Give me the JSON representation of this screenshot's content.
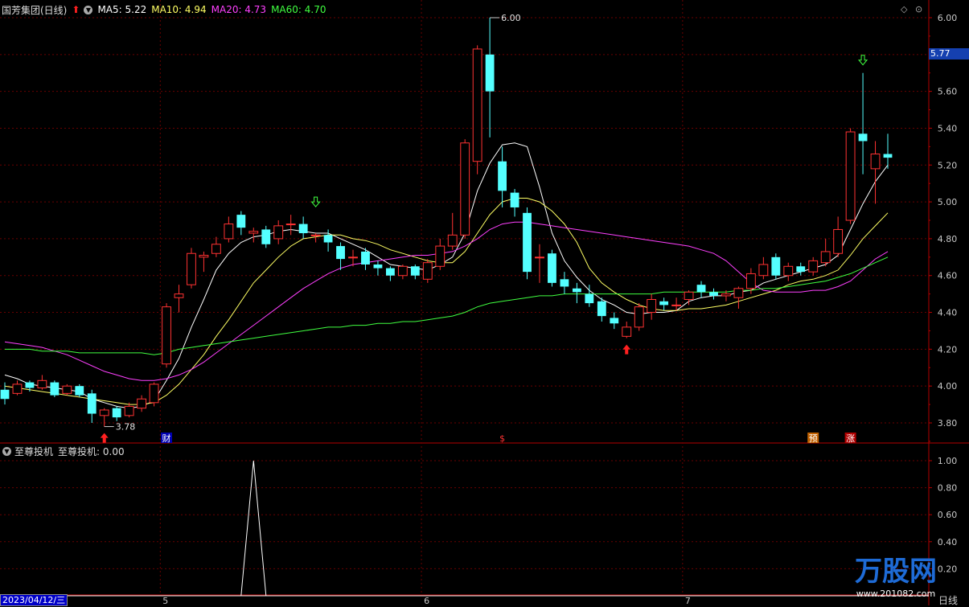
{
  "header": {
    "stock_name": "国芳集团(日线)",
    "ma5_label": "MA5: 5.22",
    "ma10_label": "MA10: 4.94",
    "ma20_label": "MA20: 4.73",
    "ma60_label": "MA60: 4.70"
  },
  "sub_header": {
    "indicator_name": "至尊投机",
    "indicator_value": "至尊投机: 0.00"
  },
  "current_price": "5.77",
  "period_label": "日线",
  "date_label": "2023/04/12/三",
  "colors": {
    "up": "#ff3232",
    "down": "#54ffff",
    "ma5": "#ffffff",
    "ma10": "#ffff64",
    "ma20": "#ff40ff",
    "ma60": "#40ff40",
    "axis": "#b40000"
  },
  "watermark": {
    "text": "万股网",
    "url": "www.201082.com"
  },
  "chart_data": {
    "type": "candlestick",
    "y_axis": {
      "ticks": [
        "6.00",
        "5.80",
        "5.60",
        "5.40",
        "5.20",
        "5.00",
        "4.80",
        "4.60",
        "4.40",
        "4.20",
        "4.00",
        "3.80"
      ],
      "ylim": [
        3.7,
        6.1
      ]
    },
    "month_labels": [
      {
        "label": "5",
        "index": 13
      },
      {
        "label": "6",
        "index": 34
      },
      {
        "label": "7",
        "index": 55
      }
    ],
    "candles": [
      [
        3.98,
        3.93,
        4.02,
        3.9
      ],
      [
        3.96,
        4.01,
        4.03,
        3.95
      ],
      [
        4.02,
        3.99,
        4.03,
        3.97
      ],
      [
        3.99,
        4.03,
        4.06,
        3.98
      ],
      [
        4.02,
        3.95,
        4.03,
        3.94
      ],
      [
        3.96,
        4.0,
        4.01,
        3.95
      ],
      [
        4.0,
        3.95,
        4.01,
        3.94
      ],
      [
        3.96,
        3.85,
        3.98,
        3.8
      ],
      [
        3.84,
        3.87,
        3.88,
        3.78
      ],
      [
        3.88,
        3.83,
        3.89,
        3.81
      ],
      [
        3.84,
        3.89,
        3.91,
        3.83
      ],
      [
        3.88,
        3.93,
        3.95,
        3.86
      ],
      [
        3.91,
        4.01,
        4.02,
        3.89
      ],
      [
        4.12,
        4.43,
        4.45,
        4.1
      ],
      [
        4.48,
        4.5,
        4.55,
        4.4
      ],
      [
        4.55,
        4.72,
        4.75,
        4.53
      ],
      [
        4.7,
        4.71,
        4.73,
        4.62
      ],
      [
        4.72,
        4.77,
        4.81,
        4.7
      ],
      [
        4.8,
        4.88,
        4.92,
        4.78
      ],
      [
        4.93,
        4.86,
        4.95,
        4.82
      ],
      [
        4.83,
        4.84,
        4.86,
        4.78
      ],
      [
        4.85,
        4.77,
        4.87,
        4.75
      ],
      [
        4.8,
        4.87,
        4.9,
        4.77
      ],
      [
        4.88,
        4.88,
        4.93,
        4.82
      ],
      [
        4.88,
        4.83,
        4.92,
        4.8
      ],
      [
        4.82,
        4.82,
        4.83,
        4.78
      ],
      [
        4.82,
        4.78,
        4.85,
        4.73
      ],
      [
        4.76,
        4.69,
        4.78,
        4.63
      ],
      [
        4.7,
        4.7,
        4.74,
        4.65
      ],
      [
        4.73,
        4.66,
        4.75,
        4.63
      ],
      [
        4.66,
        4.64,
        4.68,
        4.6
      ],
      [
        4.64,
        4.6,
        4.65,
        4.57
      ],
      [
        4.6,
        4.65,
        4.66,
        4.58
      ],
      [
        4.65,
        4.6,
        4.66,
        4.58
      ],
      [
        4.58,
        4.67,
        4.69,
        4.56
      ],
      [
        4.65,
        4.76,
        4.8,
        4.63
      ],
      [
        4.76,
        4.82,
        4.94,
        4.74
      ],
      [
        4.82,
        5.32,
        5.34,
        4.8
      ],
      [
        5.22,
        5.83,
        5.85,
        5.15
      ],
      [
        5.8,
        5.6,
        6.0,
        5.35
      ],
      [
        5.22,
        5.06,
        5.3,
        4.97
      ],
      [
        5.05,
        4.97,
        5.07,
        4.92
      ],
      [
        4.94,
        4.62,
        4.97,
        4.58
      ],
      [
        4.7,
        4.7,
        4.77,
        4.56
      ],
      [
        4.72,
        4.56,
        4.74,
        4.54
      ],
      [
        4.58,
        4.54,
        4.62,
        4.5
      ],
      [
        4.53,
        4.51,
        4.56,
        4.45
      ],
      [
        4.5,
        4.45,
        4.55,
        4.43
      ],
      [
        4.46,
        4.38,
        4.48,
        4.35
      ],
      [
        4.37,
        4.34,
        4.4,
        4.31
      ],
      [
        4.27,
        4.32,
        4.35,
        4.26
      ],
      [
        4.32,
        4.43,
        4.45,
        4.3
      ],
      [
        4.4,
        4.47,
        4.5,
        4.36
      ],
      [
        4.46,
        4.44,
        4.48,
        4.41
      ],
      [
        4.44,
        4.44,
        4.48,
        4.41
      ],
      [
        4.47,
        4.51,
        4.52,
        4.44
      ],
      [
        4.55,
        4.51,
        4.57,
        4.48
      ],
      [
        4.51,
        4.49,
        4.53,
        4.47
      ],
      [
        4.49,
        4.5,
        4.52,
        4.46
      ],
      [
        4.48,
        4.53,
        4.54,
        4.42
      ],
      [
        4.53,
        4.61,
        4.64,
        4.5
      ],
      [
        4.6,
        4.66,
        4.7,
        4.58
      ],
      [
        4.7,
        4.6,
        4.72,
        4.58
      ],
      [
        4.6,
        4.65,
        4.67,
        4.57
      ],
      [
        4.65,
        4.62,
        4.67,
        4.6
      ],
      [
        4.62,
        4.68,
        4.7,
        4.6
      ],
      [
        4.67,
        4.73,
        4.8,
        4.65
      ],
      [
        4.72,
        4.85,
        4.92,
        4.7
      ],
      [
        4.9,
        5.38,
        5.4,
        4.88
      ],
      [
        5.37,
        5.33,
        5.7,
        5.15
      ],
      [
        5.18,
        5.26,
        5.33,
        4.99
      ],
      [
        5.26,
        5.24,
        5.37,
        5.18
      ]
    ],
    "series": [
      {
        "name": "MA5",
        "values": [
          4.06,
          4.04,
          4.01,
          4.0,
          3.99,
          3.98,
          3.97,
          3.93,
          3.91,
          3.89,
          3.88,
          3.89,
          3.92,
          4.03,
          4.15,
          4.32,
          4.47,
          4.63,
          4.72,
          4.78,
          4.81,
          4.82,
          4.84,
          4.85,
          4.84,
          4.83,
          4.83,
          4.8,
          4.77,
          4.74,
          4.7,
          4.66,
          4.65,
          4.64,
          4.63,
          4.66,
          4.7,
          4.83,
          5.06,
          5.21,
          5.31,
          5.32,
          5.3,
          5.08,
          4.83,
          4.68,
          4.59,
          4.52,
          4.47,
          4.44,
          4.4,
          4.39,
          4.4,
          4.4,
          4.41,
          4.46,
          4.48,
          4.49,
          4.49,
          4.51,
          4.52,
          4.56,
          4.58,
          4.6,
          4.62,
          4.64,
          4.66,
          4.71,
          4.85,
          4.99,
          5.11,
          5.2
        ]
      },
      {
        "name": "MA10",
        "values": [
          4.0,
          3.99,
          3.98,
          3.97,
          3.96,
          3.95,
          3.94,
          3.93,
          3.92,
          3.91,
          3.9,
          3.9,
          3.91,
          3.95,
          4.01,
          4.09,
          4.17,
          4.27,
          4.36,
          4.46,
          4.56,
          4.63,
          4.7,
          4.76,
          4.8,
          4.81,
          4.82,
          4.82,
          4.8,
          4.79,
          4.77,
          4.74,
          4.72,
          4.7,
          4.68,
          4.67,
          4.67,
          4.73,
          4.83,
          4.93,
          5.0,
          5.02,
          5.02,
          5.0,
          4.95,
          4.88,
          4.78,
          4.64,
          4.56,
          4.51,
          4.47,
          4.44,
          4.42,
          4.41,
          4.41,
          4.42,
          4.42,
          4.43,
          4.44,
          4.46,
          4.48,
          4.5,
          4.52,
          4.55,
          4.57,
          4.58,
          4.6,
          4.63,
          4.71,
          4.8,
          4.87,
          4.94
        ]
      },
      {
        "name": "MA20",
        "values": [
          4.24,
          4.23,
          4.22,
          4.21,
          4.19,
          4.17,
          4.14,
          4.11,
          4.08,
          4.06,
          4.04,
          4.03,
          4.03,
          4.04,
          4.06,
          4.09,
          4.13,
          4.18,
          4.23,
          4.28,
          4.33,
          4.38,
          4.43,
          4.48,
          4.53,
          4.57,
          4.61,
          4.64,
          4.66,
          4.67,
          4.68,
          4.69,
          4.7,
          4.71,
          4.71,
          4.72,
          4.73,
          4.76,
          4.8,
          4.85,
          4.88,
          4.89,
          4.89,
          4.88,
          4.87,
          4.86,
          4.85,
          4.84,
          4.83,
          4.82,
          4.81,
          4.8,
          4.79,
          4.78,
          4.77,
          4.76,
          4.74,
          4.72,
          4.68,
          4.62,
          4.56,
          4.52,
          4.51,
          4.51,
          4.51,
          4.52,
          4.52,
          4.54,
          4.57,
          4.63,
          4.69,
          4.73
        ]
      },
      {
        "name": "MA60",
        "values": [
          4.2,
          4.2,
          4.2,
          4.19,
          4.19,
          4.19,
          4.18,
          4.18,
          4.18,
          4.18,
          4.18,
          4.18,
          4.17,
          4.18,
          4.2,
          4.21,
          4.22,
          4.23,
          4.24,
          4.25,
          4.26,
          4.27,
          4.28,
          4.29,
          4.3,
          4.31,
          4.32,
          4.32,
          4.33,
          4.33,
          4.34,
          4.34,
          4.35,
          4.35,
          4.36,
          4.37,
          4.38,
          4.4,
          4.43,
          4.45,
          4.46,
          4.47,
          4.48,
          4.49,
          4.49,
          4.5,
          4.5,
          4.5,
          4.5,
          4.5,
          4.5,
          4.5,
          4.5,
          4.51,
          4.51,
          4.51,
          4.51,
          4.51,
          4.51,
          4.52,
          4.52,
          4.53,
          4.53,
          4.54,
          4.55,
          4.56,
          4.57,
          4.59,
          4.61,
          4.64,
          4.67,
          4.7
        ]
      }
    ],
    "annotations": [
      {
        "type": "label",
        "text": "6.00",
        "index": 39,
        "value": 6.0
      },
      {
        "type": "label",
        "text": "3.78",
        "index": 8,
        "value": 3.78
      },
      {
        "type": "arrow-up",
        "index": 8,
        "value": 3.78
      },
      {
        "type": "arrow-up",
        "index": 50,
        "value": 4.26
      },
      {
        "type": "arrow-down",
        "index": 25,
        "value": 4.93
      },
      {
        "type": "arrow-down",
        "index": 69,
        "value": 5.7
      }
    ],
    "event_markers": [
      {
        "text": "财",
        "index": 13,
        "color": "#ffffff",
        "bg": "#0000b0"
      },
      {
        "text": "$",
        "index": 40,
        "color": "#ff3232",
        "bg": ""
      },
      {
        "text": "预",
        "index": 65,
        "color": "#ffffff",
        "bg": "#c06000"
      },
      {
        "text": "涨",
        "index": 68,
        "color": "#ffffff",
        "bg": "#b00000"
      }
    ],
    "indicator": {
      "name": "至尊投机",
      "y_ticks": [
        "1.00",
        "0.80",
        "0.60",
        "0.40",
        "0.20"
      ],
      "ylim": [
        0,
        1.05
      ],
      "spike_index": 20,
      "spike_value": 1.0
    }
  }
}
